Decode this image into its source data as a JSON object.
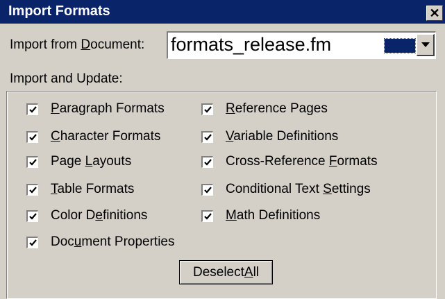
{
  "dialog": {
    "title": "Import Formats",
    "close_glyph": "✕"
  },
  "import_from": {
    "label_pre": "Import from ",
    "label_ul": "D",
    "label_post": "ocument:",
    "value": "formats_release.fm"
  },
  "group": {
    "label": "Import and Update:"
  },
  "options": [
    {
      "pre": "",
      "ul": "P",
      "post": "aragraph Formats",
      "checked": true
    },
    {
      "pre": "",
      "ul": "R",
      "post": "eference Pages",
      "checked": true
    },
    {
      "pre": "",
      "ul": "C",
      "post": "haracter Formats",
      "checked": true
    },
    {
      "pre": "",
      "ul": "V",
      "post": "ariable Definitions",
      "checked": true
    },
    {
      "pre": "Page ",
      "ul": "L",
      "post": "ayouts",
      "checked": true
    },
    {
      "pre": "Cross-Reference ",
      "ul": "F",
      "post": "ormats",
      "checked": true
    },
    {
      "pre": "",
      "ul": "T",
      "post": "able Formats",
      "checked": true
    },
    {
      "pre": "Conditional Text ",
      "ul": "S",
      "post": "ettings",
      "checked": true
    },
    {
      "pre": "Color D",
      "ul": "e",
      "post": "finitions",
      "checked": true
    },
    {
      "pre": "",
      "ul": "M",
      "post": "ath Definitions",
      "checked": true
    },
    {
      "pre": "Doc",
      "ul": "u",
      "post": "ment Properties",
      "checked": true
    }
  ],
  "deselect": {
    "pre": "Deselect ",
    "ul": "A",
    "post": "ll"
  }
}
